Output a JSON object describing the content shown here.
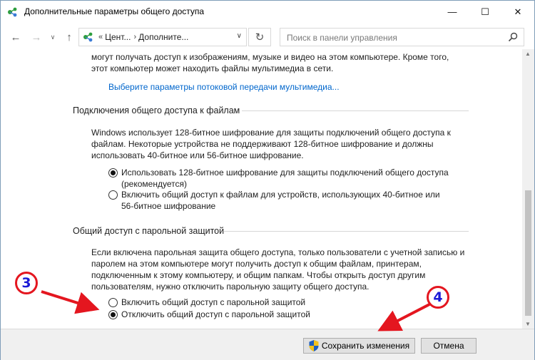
{
  "window": {
    "title": "Дополнительные параметры общего доступа",
    "controls": {
      "minimize": "—",
      "maximize": "☐",
      "close": "✕"
    }
  },
  "nav": {
    "back": "←",
    "forward": "→",
    "recent": "∨",
    "up": "↑",
    "breadcrumb_prefix": "«",
    "crumb_1": "Цент...",
    "crumb_sep": "›",
    "crumb_2": "Дополните...",
    "dropdown": "∨",
    "refresh": "↻",
    "search_placeholder": "Поиск в панели управления"
  },
  "media": {
    "line1": "могут получать доступ к изображениям, музыке и видео на этом компьютере. Кроме того,",
    "line2": "этот компьютер может находить файлы мультимедиа в сети.",
    "link": "Выберите параметры потоковой передачи мультимедиа..."
  },
  "file_sharing": {
    "heading": "Подключения общего доступа к файлам",
    "desc_line1": "Windows использует 128-битное шифрование для защиты подключений общего доступа к",
    "desc_line2": "файлам. Некоторые устройства не поддерживают 128-битное шифрование и должны",
    "desc_line3": "использовать 40-битное или 56-битное шифрование.",
    "option1_line1": "Использовать 128-битное шифрование для защиты подключений общего доступа",
    "option1_line2": "(рекомендуется)",
    "option1_selected": true,
    "option2_line1": "Включить общий доступ к файлам для устройств, использующих 40-битное или",
    "option2_line2": "56-битное шифрование",
    "option2_selected": false
  },
  "password_sharing": {
    "heading": "Общий доступ с парольной защитой",
    "desc_line1": "Если включена парольная защита общего доступа, только пользователи с учетной записью и",
    "desc_line2": "паролем на этом компьютере могут получить доступ к общим файлам, принтерам,",
    "desc_line3": "подключенным к этому компьютеру, и общим папкам. Чтобы открыть доступ другим",
    "desc_line4": "пользователям, нужно отключить парольную защиту общего доступа.",
    "option_on": "Включить общий доступ с парольной защитой",
    "option_on_selected": false,
    "option_off": "Отключить общий доступ с парольной защитой",
    "option_off_selected": true
  },
  "footer": {
    "save": "Сохранить изменения",
    "cancel": "Отмена"
  },
  "annotations": {
    "badge_3": "3",
    "badge_4": "4",
    "color": "#e4161f",
    "number_color": "#1a1ad6"
  },
  "colors": {
    "link": "#0066cc",
    "icon_green": "#2e9e3e"
  }
}
